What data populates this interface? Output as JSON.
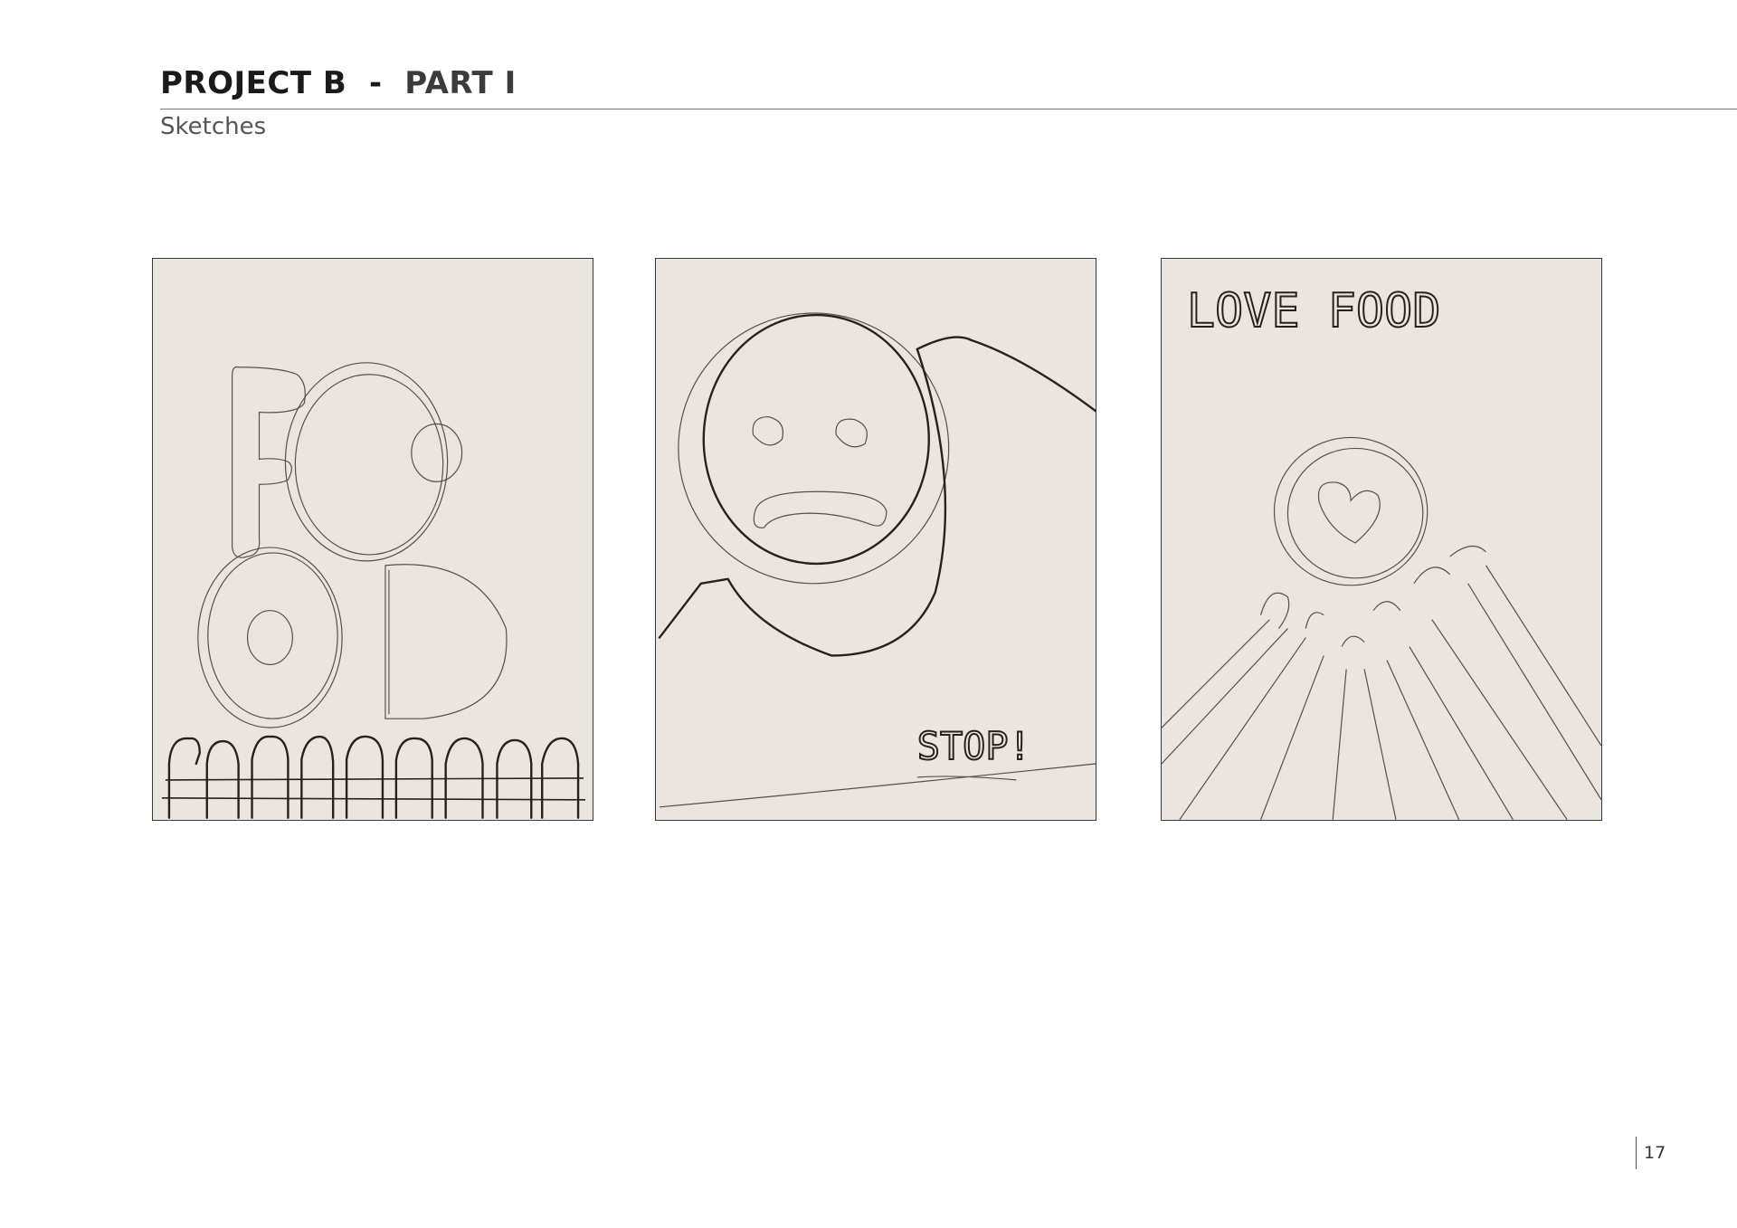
{
  "header": {
    "title_main": "PROJECT B",
    "title_sep": "-",
    "title_part": "PART I",
    "subtitle": "Sketches"
  },
  "sketches": [
    {
      "label": "sketch-food-letters"
    },
    {
      "label": "sketch-sad-face",
      "text": "STOP!"
    },
    {
      "label": "sketch-love-food",
      "text": "LOVE FOOD"
    }
  ],
  "footer": {
    "page_number": "17"
  }
}
